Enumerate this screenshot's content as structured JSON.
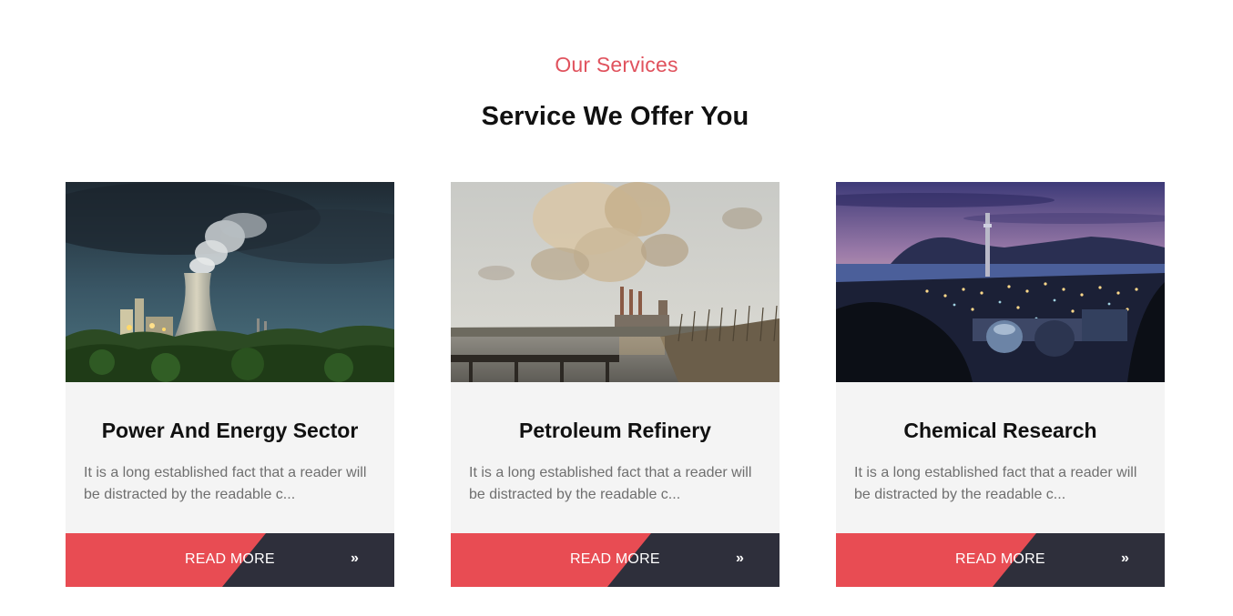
{
  "section": {
    "eyebrow": "Our Services",
    "heading": "Service We Offer You"
  },
  "colors": {
    "accent": "#e84c53",
    "eyebrow": "#e0525d",
    "dark_button": "#2e2f3b",
    "card_background": "#f4f4f4"
  },
  "cards": [
    {
      "title": "Power And Energy Sector",
      "text": "It is a long established fact that a reader will be distracted by the readable c...",
      "button_label": "READ MORE",
      "button_icon": "double-chevron-right-icon"
    },
    {
      "title": "Petroleum Refinery",
      "text": "It is a long established fact that a reader will be distracted by the readable c...",
      "button_label": "READ MORE",
      "button_icon": "double-chevron-right-icon"
    },
    {
      "title": "Chemical Research",
      "text": "It is a long established fact that a reader will be distracted by the readable c...",
      "button_label": "READ MORE",
      "button_icon": "double-chevron-right-icon"
    }
  ]
}
